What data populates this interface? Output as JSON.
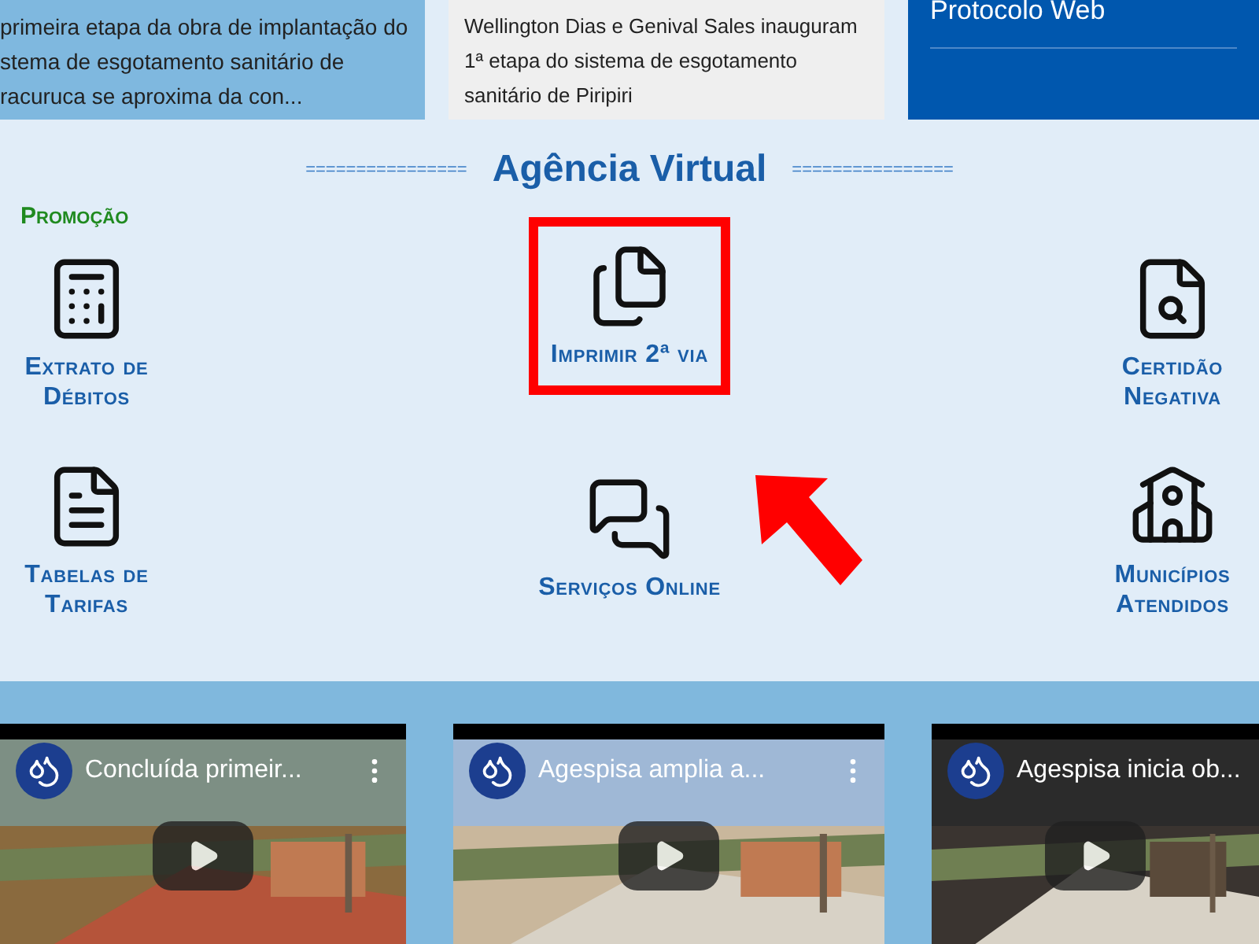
{
  "news": [
    {
      "text": "primeira etapa da obra de implantação do\nstema de esgotamento sanitário de\nracuruca se aproxima da con..."
    },
    {
      "text": "Wellington Dias e Genival Sales inauguram 1ª etapa do sistema de esgotamento sanitário de Piripiri"
    }
  ],
  "side_menu": {
    "item": "Protocolo Web"
  },
  "agencia": {
    "title": "Agência Virtual",
    "divider": "================",
    "promo_label": "Promoção",
    "services": [
      {
        "label": "Extrato de\nDébitos",
        "highlighted": false
      },
      {
        "label": "Imprimir 2ª via",
        "highlighted": true
      },
      {
        "label": "Certidão\nNegativa",
        "highlighted": false
      },
      {
        "label": "Tabelas de\nTarifas",
        "highlighted": false
      },
      {
        "label": "Serviços Online",
        "highlighted": false
      },
      {
        "label": "Municípios\nAtendidos",
        "highlighted": false
      }
    ]
  },
  "videos": [
    {
      "title": "Concluída primeir...",
      "menu": true
    },
    {
      "title": "Agespisa amplia a...",
      "menu": true
    },
    {
      "title": "Agespisa inicia ob...",
      "menu": false
    }
  ]
}
